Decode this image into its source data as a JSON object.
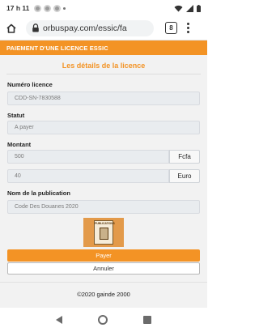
{
  "status_bar": {
    "time": "17 h 11"
  },
  "browser": {
    "url": "orbuspay.com/essic/fa",
    "tab_count": "8"
  },
  "page": {
    "header": "PAIEMENT D'UNE LICENCE ESSIC",
    "section_title": "Les détails de la licence",
    "fields": {
      "numero_label": "Numéro licence",
      "numero_value": "CDD-SN-7830588",
      "statut_label": "Statut",
      "statut_value": "A payer",
      "montant_label": "Montant",
      "montant_fcfa_value": "500",
      "montant_fcfa_unit": "Fcfa",
      "montant_euro_value": "40",
      "montant_euro_unit": "Euro",
      "publication_label": "Nom de la publication",
      "publication_value": "Code Des Douanes 2020"
    },
    "publication_image_text": "PUBLICATIONS",
    "pay_button": "Payer",
    "cancel_button": "Annuler",
    "footer": "©2020 gainde 2000"
  },
  "colors": {
    "accent": "#f39325",
    "field_bg": "#e9ecef",
    "page_bg": "#f2f2f2"
  }
}
